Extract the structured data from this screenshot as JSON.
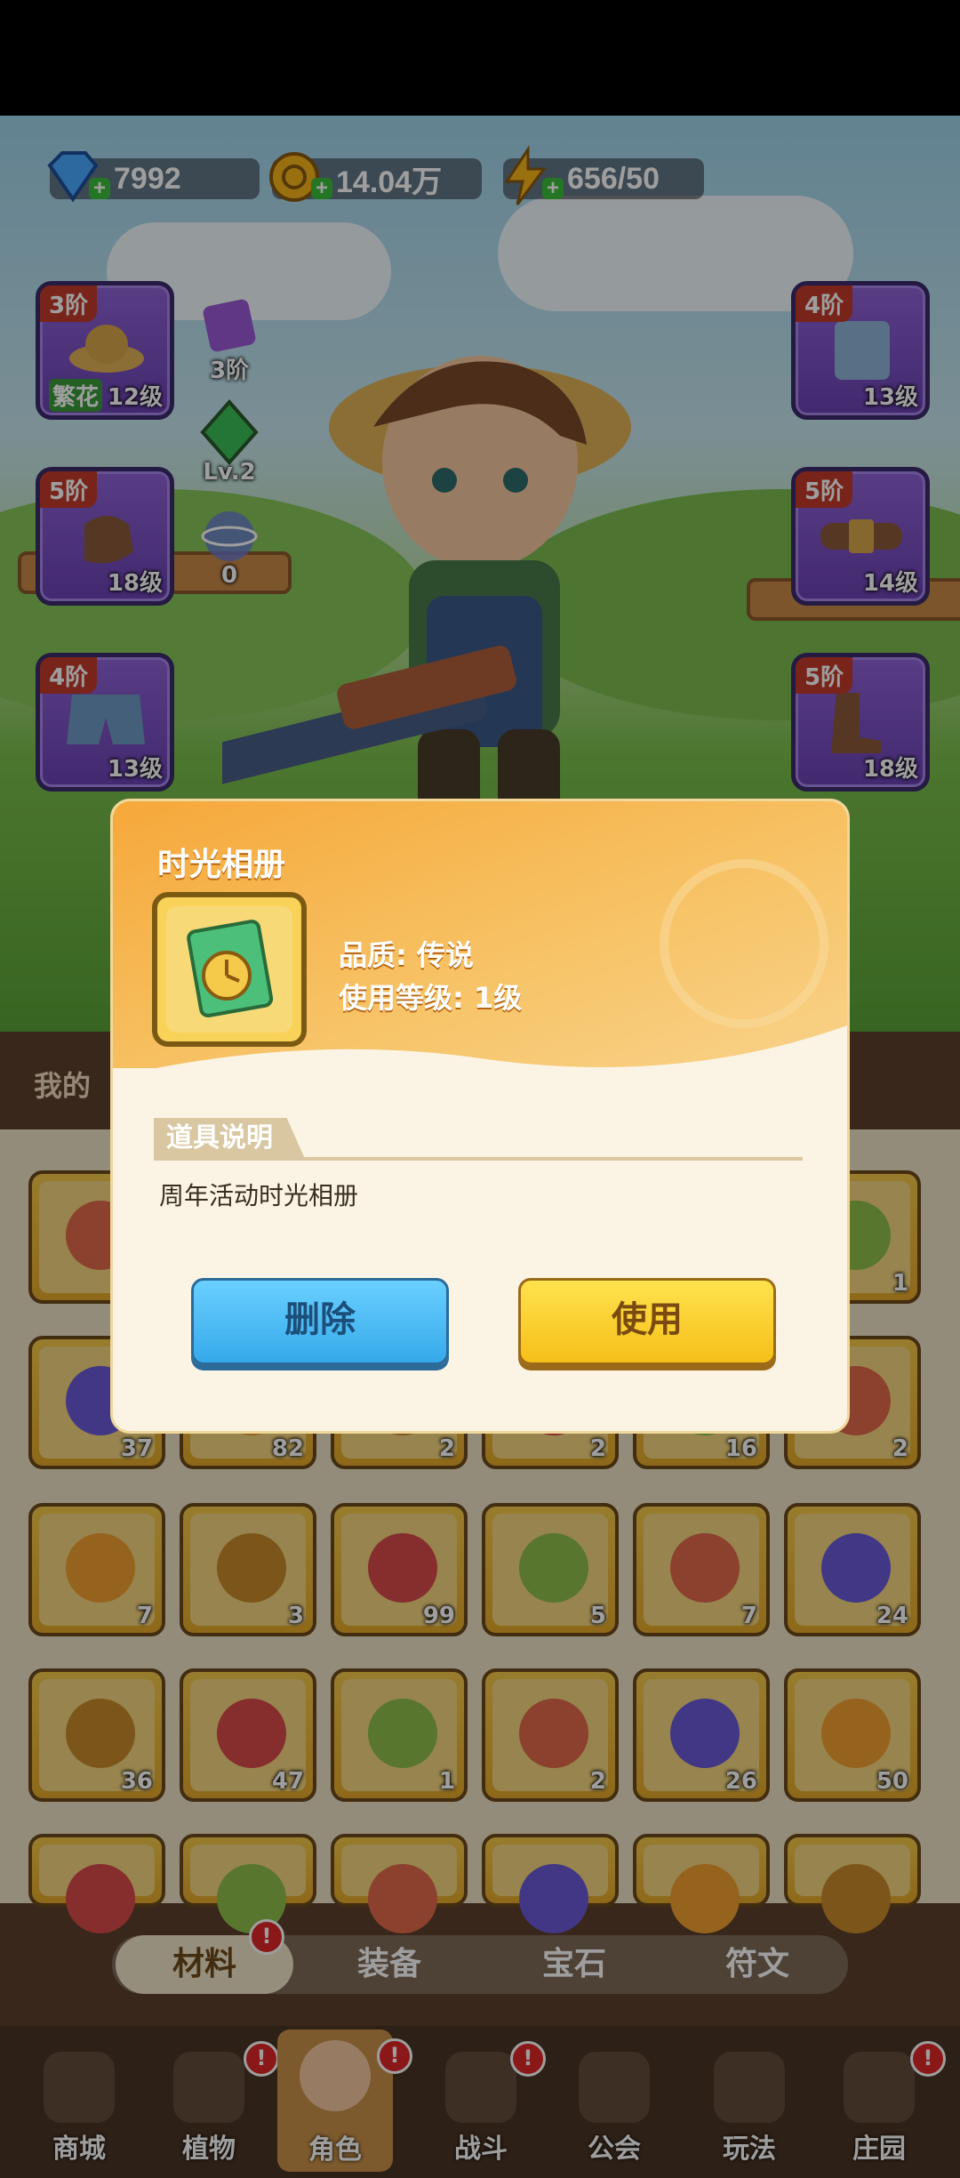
{
  "currencies": [
    {
      "name": "diamond",
      "value": "7992",
      "icon": "diamond-icon",
      "color": "#4aa8ff"
    },
    {
      "name": "gold",
      "value": "14.04万",
      "icon": "gold-coin-icon",
      "color": "#f5b51b"
    },
    {
      "name": "energy",
      "value": "656/50",
      "icon": "lightning-icon",
      "color": "#f5b51b"
    }
  ],
  "equipment_left": [
    {
      "tier": "3阶",
      "tag": "繁花",
      "level": "12级",
      "icon": "straw-hat-icon"
    },
    {
      "tier": "5阶",
      "level": "18级",
      "icon": "glove-icon"
    },
    {
      "tier": "4阶",
      "level": "13级",
      "icon": "shorts-icon"
    }
  ],
  "equipment_right": [
    {
      "tier": "4阶",
      "level": "13级",
      "icon": "overalls-icon"
    },
    {
      "tier": "5阶",
      "level": "14级",
      "icon": "belt-icon"
    },
    {
      "tier": "5阶",
      "level": "18级",
      "icon": "boots-icon"
    }
  ],
  "character_stats": [
    {
      "label": "3阶",
      "icon": "purple-gem-icon"
    },
    {
      "label": "Lv.2",
      "icon": "green-crystal-icon"
    },
    {
      "label": "0",
      "icon": "orbit-icon"
    }
  ],
  "inventory": {
    "title": "我的",
    "rows": [
      [
        {
          "count": ""
        },
        {
          "count": ""
        },
        {
          "count": ""
        },
        {
          "count": ""
        },
        {
          "count": ""
        },
        {
          "count": "1"
        }
      ],
      [
        {
          "count": "37"
        },
        {
          "count": "82"
        },
        {
          "count": "2"
        },
        {
          "count": "2"
        },
        {
          "count": "16"
        },
        {
          "count": "2"
        }
      ],
      [
        {
          "count": "7"
        },
        {
          "count": "3"
        },
        {
          "count": "99"
        },
        {
          "count": "5"
        },
        {
          "count": "7"
        },
        {
          "count": "24"
        }
      ],
      [
        {
          "count": "36"
        },
        {
          "count": "47"
        },
        {
          "count": "1"
        },
        {
          "count": "2"
        },
        {
          "count": "26"
        },
        {
          "count": "50"
        }
      ],
      [
        {
          "count": ""
        },
        {
          "count": ""
        },
        {
          "count": ""
        },
        {
          "count": ""
        },
        {
          "count": ""
        },
        {
          "count": ""
        }
      ]
    ]
  },
  "tabs": [
    "材料",
    "装备",
    "宝石",
    "符文"
  ],
  "active_tab": "材料",
  "nav": [
    "商城",
    "植物",
    "角色",
    "战斗",
    "公会",
    "玩法",
    "庄园"
  ],
  "dialog": {
    "title": "时光相册",
    "quality": "品质: 传说",
    "use_level": "使用等级: 1级",
    "section_label": "道具说明",
    "description": "周年活动时光相册",
    "delete_label": "删除",
    "use_label": "使用"
  },
  "alert_mark": "!"
}
